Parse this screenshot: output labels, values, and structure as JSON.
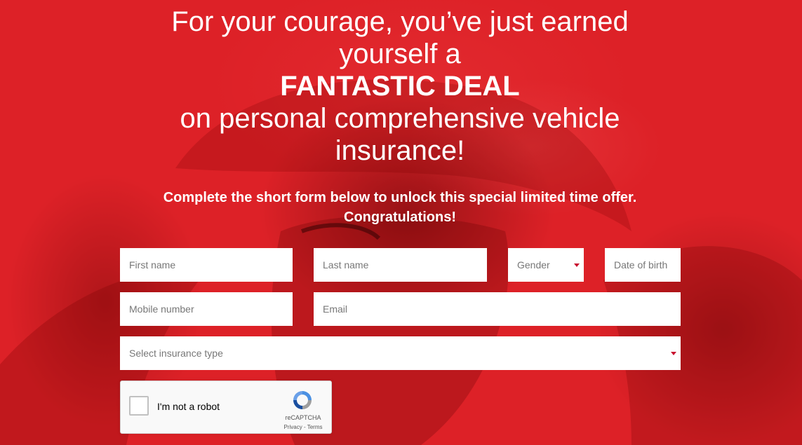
{
  "hero": {
    "line1": "For your courage, you’ve just earned",
    "line2": "yourself a",
    "highlight": "FANTASTIC DEAL",
    "line3": "on personal comprehensive vehicle",
    "line4": "insurance!"
  },
  "intro": {
    "line1": "Complete the short form below to unlock this special limited time offer.",
    "line2": "Congratulations!"
  },
  "form": {
    "first_name": {
      "placeholder": "First name"
    },
    "last_name": {
      "placeholder": "Last name"
    },
    "gender": {
      "placeholder": "Gender"
    },
    "dob": {
      "placeholder": "Date of birth"
    },
    "mobile": {
      "placeholder": "Mobile number"
    },
    "email": {
      "placeholder": "Email"
    },
    "insurance_type": {
      "placeholder": "Select insurance type"
    }
  },
  "recaptcha": {
    "label": "I'm not a robot",
    "brand": "reCAPTCHA",
    "terms": "Privacy - Terms"
  },
  "colors": {
    "brand_red": "#dd2127",
    "caret_red": "#c8102e"
  }
}
